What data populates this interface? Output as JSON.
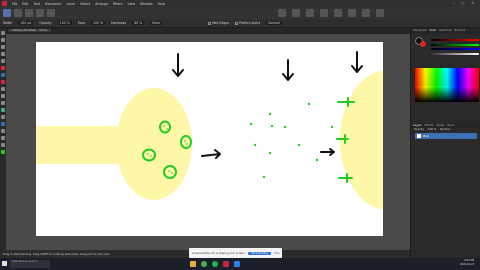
{
  "menu": [
    "File",
    "Edit",
    "Text",
    "Document",
    "Layer",
    "Select",
    "Arrange",
    "Filters",
    "View",
    "Window",
    "Help"
  ],
  "window_controls": [
    "–",
    "□",
    "✕"
  ],
  "context_toolbar": {
    "tool": "Width",
    "width": "100 px",
    "opacity_label": "Opacity",
    "opacity": "100 %",
    "flow_label": "Flow",
    "flow": "100 %",
    "hardness_label": "Hardness",
    "hardness": "80 %",
    "more": "More",
    "wet_edges": "Wet Edges",
    "protect_alpha": "Protect Alpha",
    "mode": "Normal"
  },
  "document_tab": "Untitled (Modified) – 50.0%",
  "panel": {
    "tabs": [
      "Histogram",
      "Color",
      "Swatches",
      "Brushes"
    ],
    "active_tab": "Color",
    "layer_tabs": [
      "Layers",
      "Effects",
      "Styles",
      "Stock"
    ],
    "layer_header": [
      "Opacity",
      "100 %",
      "Normal"
    ],
    "layer_name": "Pixel"
  },
  "status_hint": "Drag to start painting. Drag+SHIFT to continue last stroke. Drag+ALT to pick color.",
  "toast": {
    "text": "screencastify.com is sharing your screen.",
    "button": "Stop sharing",
    "hide": "Hide"
  },
  "taskbar": {
    "search": "Type here to search",
    "time": "6:02 PM",
    "date": "2022-01-23"
  },
  "colors": {
    "accent_blue": "#3d6fb6",
    "canvas_bg": "#ffffff",
    "cell_yellow": "#fff7a8",
    "cell_green": "#22cc22",
    "ink": "#111111"
  }
}
